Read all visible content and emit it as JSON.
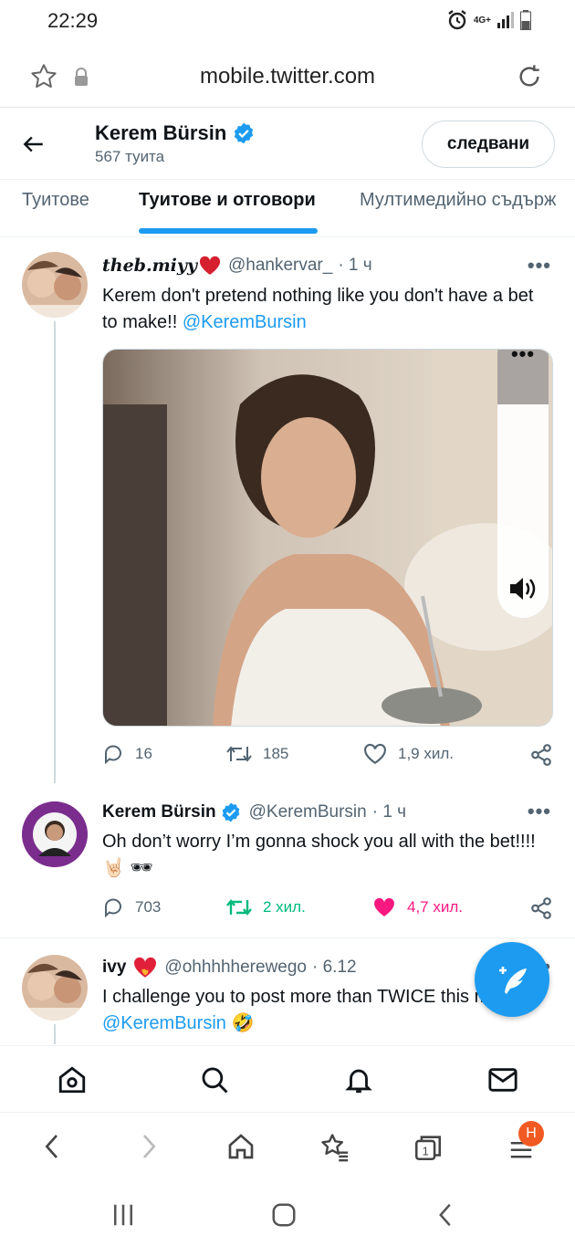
{
  "status_bar": {
    "time": "22:29",
    "network": "4G+"
  },
  "browser": {
    "url": "mobile.twitter.com"
  },
  "profile": {
    "name": "Kerem Bürsin",
    "tweet_count": "567 туита",
    "follow_label": "следвани"
  },
  "tabs": [
    {
      "label": "Туитове"
    },
    {
      "label": "Туитове и отговори"
    },
    {
      "label": "Мултимедийно съдърж"
    }
  ],
  "tweets": [
    {
      "name": "theb.miyy",
      "handle": "@hankervar_",
      "time": "· 1 ч",
      "text": "Kerem don't pretend nothing like you don't have a bet to make!! ",
      "mention": "@KeremBursin",
      "replies": "16",
      "retweets": "185",
      "likes": "1,9 хил."
    },
    {
      "name": "Kerem Bürsin",
      "handle": "@KeremBursin",
      "time": "· 1 ч",
      "text": "Oh don’t worry I’m gonna shock you all with the bet!!!! 🤘🏻 🕶",
      "replies": "703",
      "retweets": "2 хил.",
      "likes": "4,7 хил."
    },
    {
      "name": "ivy",
      "handle": "@ohhhhherewego",
      "time": "· 6.12",
      "text": "I challenge you to post more than TWICE this month ",
      "mention": "@KeremBursin",
      "emoji": "🤣"
    }
  ],
  "colors": {
    "accent": "#1d9bf0",
    "retweet_active": "#00ba7c",
    "like_active": "#f91880",
    "badge": "#f15a22"
  },
  "browser_badge": "H"
}
